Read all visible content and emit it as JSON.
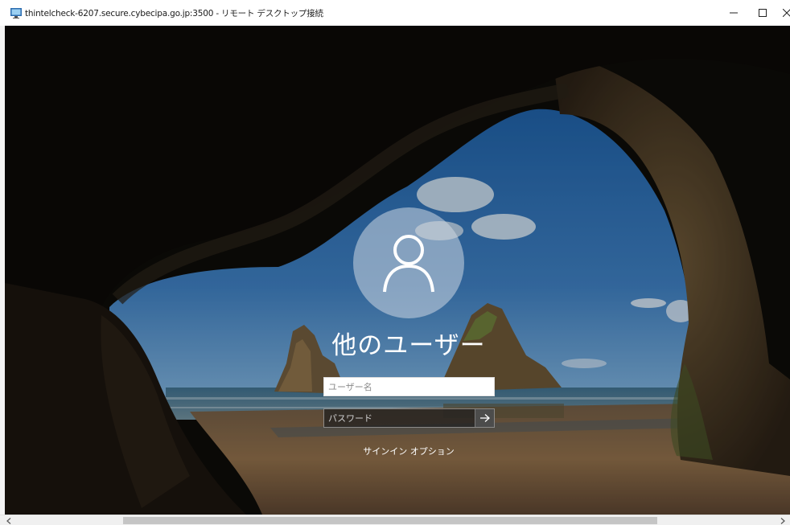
{
  "window": {
    "title": "thintelcheck-6207.secure.cybecipa.go.jp:3500 - リモート デスクトップ接続",
    "minimize_icon": "minimize-icon",
    "maximize_icon": "maximize-icon",
    "close_icon": "close-icon"
  },
  "login": {
    "avatar_icon": "user-icon",
    "user_label": "他のユーザー",
    "username_placeholder": "ユーザー名",
    "password_placeholder": "パスワード",
    "submit_icon": "arrow-right-icon",
    "signin_options_label": "サインイン オプション"
  },
  "scrollbar": {
    "left_icon": "chevron-left-icon",
    "right_icon": "chevron-right-icon"
  },
  "colors": {
    "sky": "#3a6ea8",
    "sand": "#8a6a45",
    "cave": "#0f0c09"
  }
}
